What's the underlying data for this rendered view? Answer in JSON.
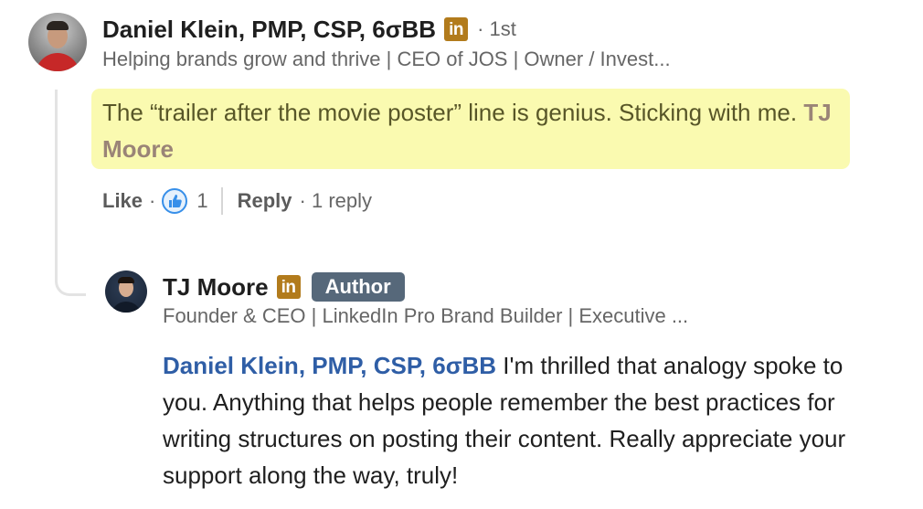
{
  "comment": {
    "author": {
      "name": "Daniel Klein, PMP, CSP, 6σBB",
      "badge_icon": "linkedin-icon",
      "connection_degree": "· 1st",
      "headline": "Helping brands grow and thrive | CEO of JOS | Owner / Invest..."
    },
    "text": "The “trailer after the movie poster” line is genius. Sticking with me.",
    "mention": "TJ Moore",
    "highlight_color": "#fafab0",
    "actions": {
      "like_label": "Like",
      "dot": "·",
      "like_count": "1",
      "reply_label": "Reply",
      "replies_count": "· 1 reply"
    }
  },
  "reply": {
    "author": {
      "name": "TJ Moore",
      "badge_icon": "linkedin-icon",
      "author_badge": "Author",
      "headline": "Founder & CEO | LinkedIn Pro Brand Builder | Executive ..."
    },
    "mention": "Daniel Klein, PMP, CSP, 6σBB",
    "text": "I'm thrilled that analogy spoke to you. Anything that helps people remember the best practices for writing structures on posting their content. Really appreciate your support along the way, truly!"
  },
  "colors": {
    "mention_blue": "#2f5ea6",
    "linkedin_badge": "#b27b1c",
    "author_badge_bg": "#56687a",
    "like_blue": "#378fe9"
  }
}
